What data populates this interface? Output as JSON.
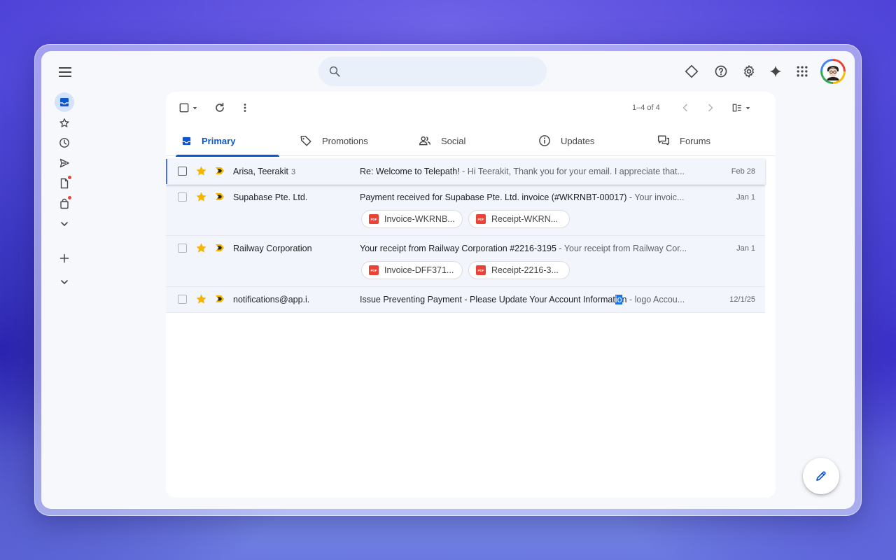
{
  "search": {
    "placeholder": ""
  },
  "pager": {
    "text": "1–4 of 4"
  },
  "tabs": [
    {
      "label": "Primary"
    },
    {
      "label": "Promotions"
    },
    {
      "label": "Social"
    },
    {
      "label": "Updates"
    },
    {
      "label": "Forums"
    }
  ],
  "emails": [
    {
      "sender": "Arisa, Teerakit",
      "count": "3",
      "subject": "Re: Welcome to Telepath!",
      "snippet": " - Hi Teerakit, Thank you for your email. I appreciate that...",
      "date": "Feb 28"
    },
    {
      "sender": "Supabase Pte. Ltd.",
      "subject": "Payment received for Supabase Pte. Ltd. invoice (#WKRNBT-00017)",
      "snippet": " - Your invoic...",
      "date": "Jan 1",
      "attachments": [
        "Invoice-WKRNB...",
        "Receipt-WKRN..."
      ]
    },
    {
      "sender": "Railway Corporation",
      "subject": "Your receipt from Railway Corporation #2216-3195",
      "snippet": " - Your receipt from Railway Cor...",
      "date": "Jan 1",
      "attachments": [
        "Invoice-DFF371...",
        "Receipt-2216-3..."
      ]
    },
    {
      "sender": "notifications@app.i.",
      "subject_pre": "Issue Preventing Payment - Please Update Your Account Informat",
      "subject_hl": "io",
      "subject_post": "n",
      "snippet": " - logo Accou...",
      "date": "12/1/25"
    }
  ],
  "attachment_icon": "PDF",
  "colors": {
    "accent": "#0b57d0",
    "star": "#f4b400",
    "badge": "#ea4335"
  }
}
